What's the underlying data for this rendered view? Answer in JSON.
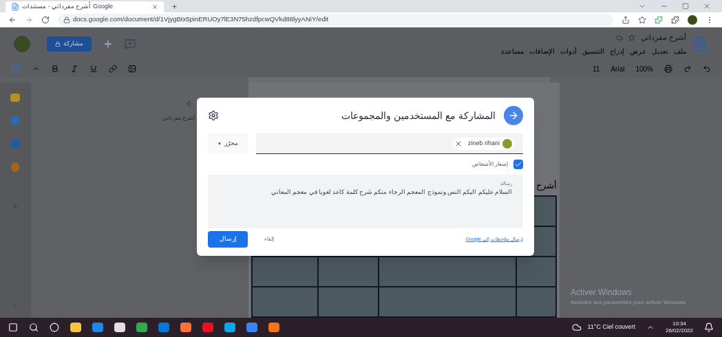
{
  "browser": {
    "tab_title": "أشرح مفرداتي - مستندات Google",
    "new_tab": "+",
    "url": "docs.google.com/document/d/1VjygBtx5pinERUOy7lE3N75hzdfpcwQVkd88lyyANiY/edit"
  },
  "docs": {
    "title": "أشرح مفرداتي",
    "menus": [
      "ملف",
      "تعديل",
      "عرض",
      "إدراج",
      "التنسيق",
      "أدوات",
      "الإضافات",
      "مساعدة"
    ],
    "share_button": "مشاركة",
    "toolbar": {
      "zoom": "100%",
      "font": "Arial",
      "font_size": "11"
    },
    "outline_title": "أشرح مفرداتي",
    "page_heading": "أشرح"
  },
  "dialog": {
    "title": "المشاركة مع المستخدمين والمجموعات",
    "recipient": "zineb rihani",
    "role": "محرّر",
    "role_caret": "▼",
    "notify": {
      "label": "إشعار الأشخاص",
      "checked": true
    },
    "message": {
      "label": "رسالة",
      "value": "السلام عليكم اليكم النص ونموذج المعجم الرجاء منكم شرح كلمة كاعد لغويا في معجم المعاني"
    },
    "send_button": "إرسال",
    "cancel_button": "إلغاء",
    "feedback_link": "إرسال ملاحظات إلى Google"
  },
  "windows_activation": {
    "title": "Activer Windows",
    "subtitle": "Accédez aux paramètres pour activer Windows"
  },
  "taskbar": {
    "weather": "11°C Ciel couvert",
    "time": "10:34",
    "date": "26/02/2022"
  }
}
